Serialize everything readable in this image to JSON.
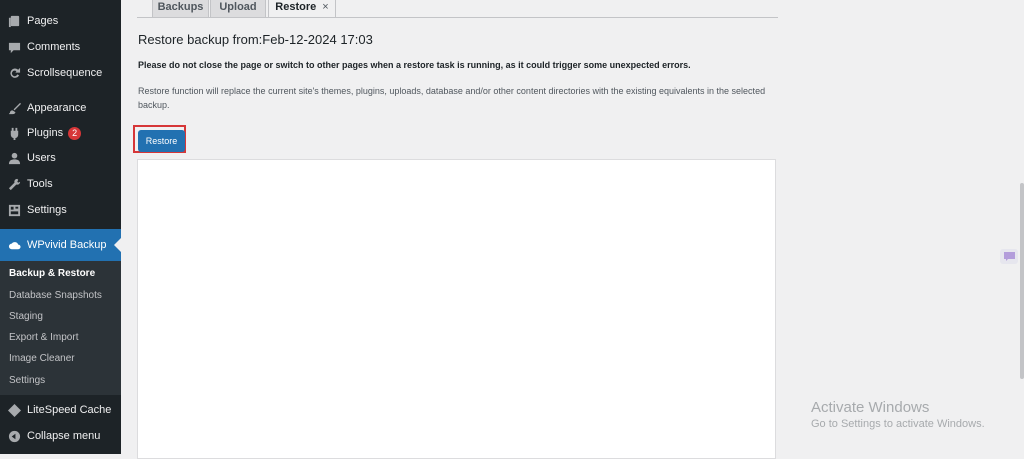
{
  "sidebar": {
    "items": [
      {
        "label": "Pages",
        "icon": "pages-icon"
      },
      {
        "label": "Comments",
        "icon": "comments-icon"
      },
      {
        "label": "Scrollsequence",
        "icon": "scrollsequence-icon"
      },
      {
        "label": "Appearance",
        "icon": "brush-icon"
      },
      {
        "label": "Plugins",
        "icon": "plugin-icon",
        "badge": "2"
      },
      {
        "label": "Users",
        "icon": "users-icon"
      },
      {
        "label": "Tools",
        "icon": "wrench-icon"
      },
      {
        "label": "Settings",
        "icon": "settings-icon"
      },
      {
        "label": "WPvivid Backup",
        "icon": "cloud-icon"
      },
      {
        "label": "LiteSpeed Cache",
        "icon": "litespeed-icon"
      },
      {
        "label": "Collapse menu",
        "icon": "collapse-icon"
      }
    ],
    "submenu": [
      "Backup & Restore",
      "Database Snapshots",
      "Staging",
      "Export & Import",
      "Image Cleaner",
      "Settings"
    ]
  },
  "tabs": [
    {
      "label": "Backups"
    },
    {
      "label": "Upload"
    },
    {
      "label": "Restore",
      "close": "×"
    }
  ],
  "main": {
    "title": "Restore backup from:Feb-12-2024 17:03",
    "notice": "Please do not close the page or switch to other pages when a restore task is running, as it could trigger some unexpected errors.",
    "description": "Restore function will replace the current site's themes, plugins, uploads, database and/or other content directories with the existing equivalents in the selected backup.",
    "restore_button": "Restore"
  },
  "windows_watermark": {
    "title": "Activate Windows",
    "subtitle": "Go to Settings to activate Windows."
  },
  "colors": {
    "sidebar_bg": "#1d2327",
    "accent": "#2271b1",
    "highlight_border": "#d63638",
    "page_bg": "#f0f0f1"
  }
}
